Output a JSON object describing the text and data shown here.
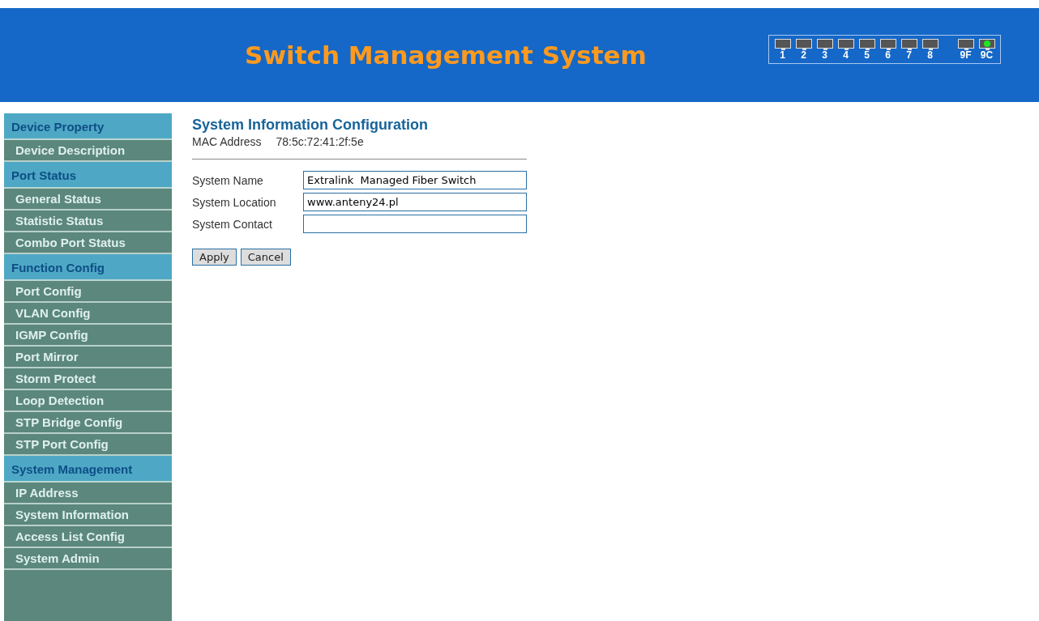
{
  "header": {
    "title": "Switch Management System",
    "ports": [
      {
        "label": "1",
        "link": false
      },
      {
        "label": "2",
        "link": false
      },
      {
        "label": "3",
        "link": false
      },
      {
        "label": "4",
        "link": false
      },
      {
        "label": "5",
        "link": false
      },
      {
        "label": "6",
        "link": false
      },
      {
        "label": "7",
        "link": false
      },
      {
        "label": "8",
        "link": false
      },
      {
        "label": "9F",
        "link": false
      },
      {
        "label": "9C",
        "link": true
      }
    ]
  },
  "sidebar": {
    "sections": [
      {
        "title": "Device Property",
        "items": [
          "Device Description"
        ]
      },
      {
        "title": "Port Status",
        "items": [
          "General Status",
          "Statistic Status",
          "Combo Port Status"
        ]
      },
      {
        "title": "Function Config",
        "items": [
          "Port Config",
          "VLAN Config",
          "IGMP Config",
          "Port Mirror",
          "Storm Protect",
          "Loop Detection",
          "STP Bridge Config",
          "STP Port Config"
        ]
      },
      {
        "title": "System Management",
        "items": [
          "IP Address",
          "System Information",
          "Access List Config",
          "System Admin"
        ]
      }
    ]
  },
  "content": {
    "title": "System Information Configuration",
    "mac_label": "MAC Address",
    "mac_value": "78:5c:72:41:2f:5e",
    "fields": [
      {
        "label": "System Name",
        "value": "Extralink  Managed Fiber Switch"
      },
      {
        "label": "System Location",
        "value": "www.anteny24.pl"
      },
      {
        "label": "System Contact"
      }
    ],
    "buttons": [
      "Apply",
      "Cancel"
    ]
  }
}
